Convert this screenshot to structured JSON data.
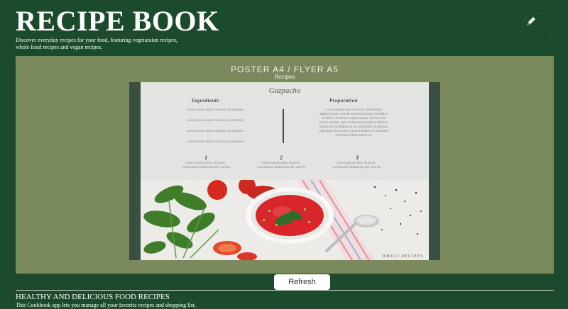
{
  "header": {
    "title": "RECIPE BOOK",
    "description": "Discover everyday recipes for your food, featuring vegetaraian recipes, whole food recipes and vegan recipes.",
    "edit_icon": "pen-icon"
  },
  "preview": {
    "title": "POSTER A4 / FLYER A5",
    "subtitle": "Recipes",
    "recipe_title": "Gazpacho",
    "ingredients_heading": "Ingredients",
    "preparation_heading": "Preparation",
    "ingredients_lines": [
      "Lorem ipsum dolor sit amet, consectetur",
      "Lorem ipsum dolor sit amet, consectetur",
      "Lorem ipsum dolor sit amet, consectetur",
      "Lorem ipsum dolor sit amet, consectetur"
    ],
    "preparation_text": "Lorem ipsum dolor sit amet, consectetur adipiscing elit, sed do eiusmod tempor incididunt ut labore et dolore magna aliqua. Ut enim ad minim veniam, quis nostrud exercitation ullamco laboris nisi ut aliquip ex ea commodo consequat. Duis aute irure dolor in reprehenderit in voluptate velit esse cillum dolore eu",
    "steps": [
      {
        "num": "1",
        "text": "Lorem ipsum dolor sit amet, consectetur adipiscing elit, sed do"
      },
      {
        "num": "2",
        "text": "Lorem ipsum dolor sit amet, consectetur adipiscing elit, sed do"
      },
      {
        "num": "3",
        "text": "Lorem ipsum dolor sit amet, consectetur adipiscing elit, sed do"
      }
    ],
    "brand": "WHEAT RECIPES"
  },
  "actions": {
    "refresh_label": "Refresh"
  },
  "footer": {
    "title": "HEALTHY AND DELICIOUS FOOD RECIPES",
    "text": "This Cookbook app lets you manage all your favorite recipes and shopping list."
  },
  "colors": {
    "background": "#1b4a2c",
    "preview_panel": "#7b8a5d",
    "poster_border": "#3b4f40",
    "poster_page": "#e3e3e1",
    "soup": "#d8262b"
  }
}
